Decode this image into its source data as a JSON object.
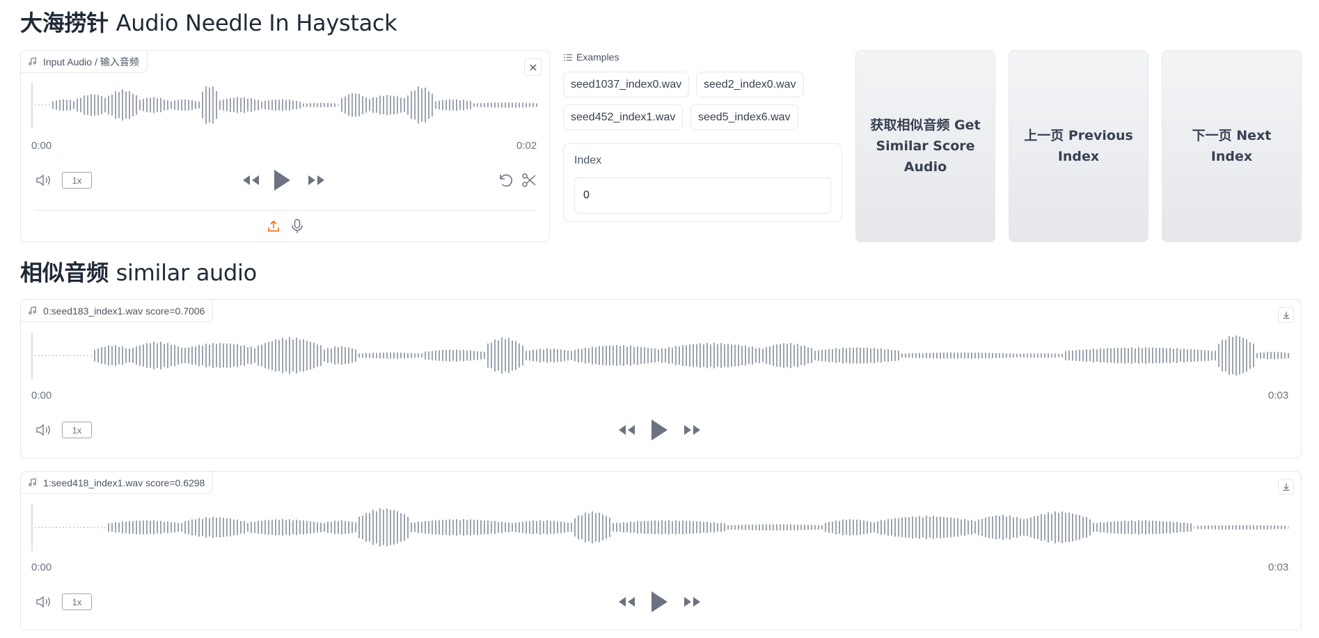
{
  "header": {
    "title_cn": "大海捞针",
    "title_en": "Audio Needle In Haystack"
  },
  "input_audio": {
    "label": "Input Audio / 输入音频",
    "time_start": "0:00",
    "time_end": "0:02",
    "rate": "1x"
  },
  "examples": {
    "label": "Examples",
    "items": [
      "seed1037_index0.wav",
      "seed2_index0.wav",
      "seed452_index1.wav",
      "seed5_index6.wav"
    ]
  },
  "index": {
    "label": "Index",
    "value": "0"
  },
  "buttons": {
    "get_similar": "获取相似音频 Get Similar Score Audio",
    "previous": "上一页 Previous Index",
    "next": "下一页 Next Index"
  },
  "results": {
    "title_cn": "相似音频",
    "title_en": "similar audio",
    "items": [
      {
        "label": "0:seed183_index1.wav score=0.7006",
        "time_start": "0:00",
        "time_end": "0:03",
        "rate": "1x"
      },
      {
        "label": "1:seed418_index1.wav score=0.6298",
        "time_start": "0:00",
        "time_end": "0:03",
        "rate": "1x"
      }
    ]
  },
  "colors": {
    "accent": "#f97316",
    "waveform": "#9ca3af",
    "text": "#1f2937",
    "border": "#e5e7eb"
  },
  "icons": [
    "music-note-icon",
    "close-icon",
    "volume-icon",
    "rewind-icon",
    "play-icon",
    "fast-forward-icon",
    "undo-icon",
    "scissors-icon",
    "upload-icon",
    "microphone-icon",
    "list-icon",
    "download-icon"
  ]
}
